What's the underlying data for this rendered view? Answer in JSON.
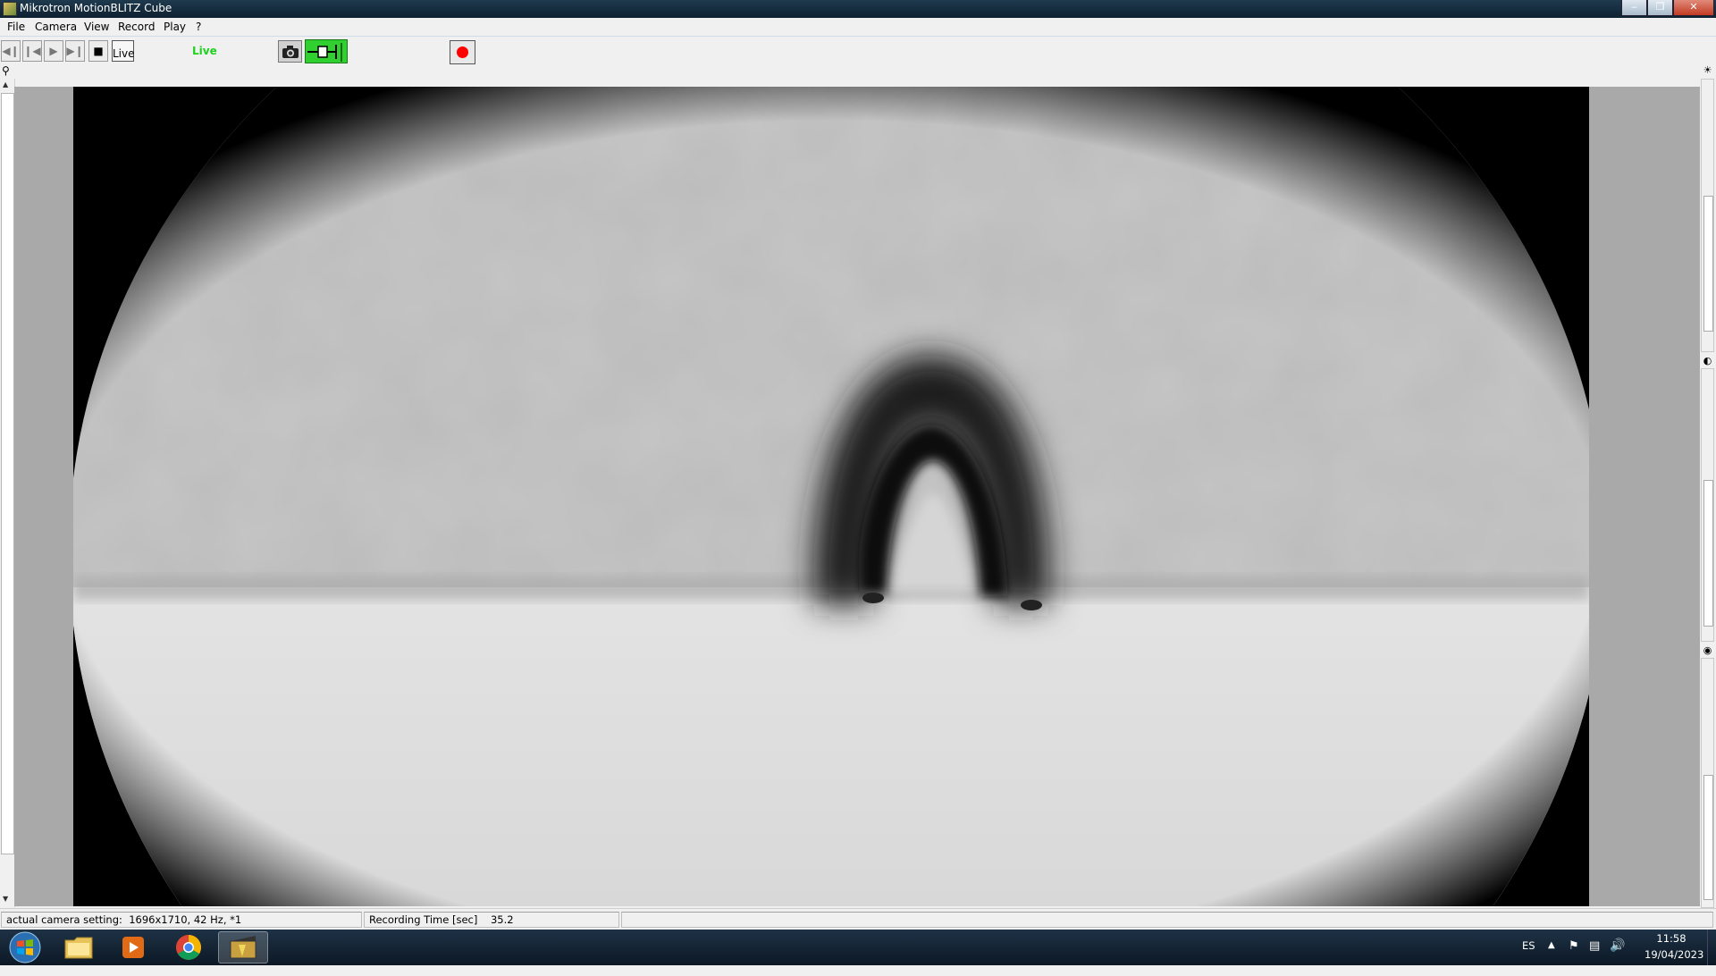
{
  "window": {
    "title": "Mikrotron MotionBLITZ Cube",
    "buttons": [
      "‒",
      "❒",
      "✕"
    ]
  },
  "menu": [
    "File",
    "Camera",
    "View",
    "Record",
    "Play",
    "?"
  ],
  "toolbar": {
    "live_button": "Live",
    "live_status": "Live",
    "live_status_color": "#1fd11f"
  },
  "statusbar": {
    "camera_label": "actual camera setting:",
    "camera_value": "1696x1710, 42 Hz, *1",
    "recording_label": "Recording Time [sec]",
    "recording_value": "35.2"
  },
  "taskbar": {
    "language": "ES",
    "time": "11:58",
    "date": "19/04/2023"
  }
}
